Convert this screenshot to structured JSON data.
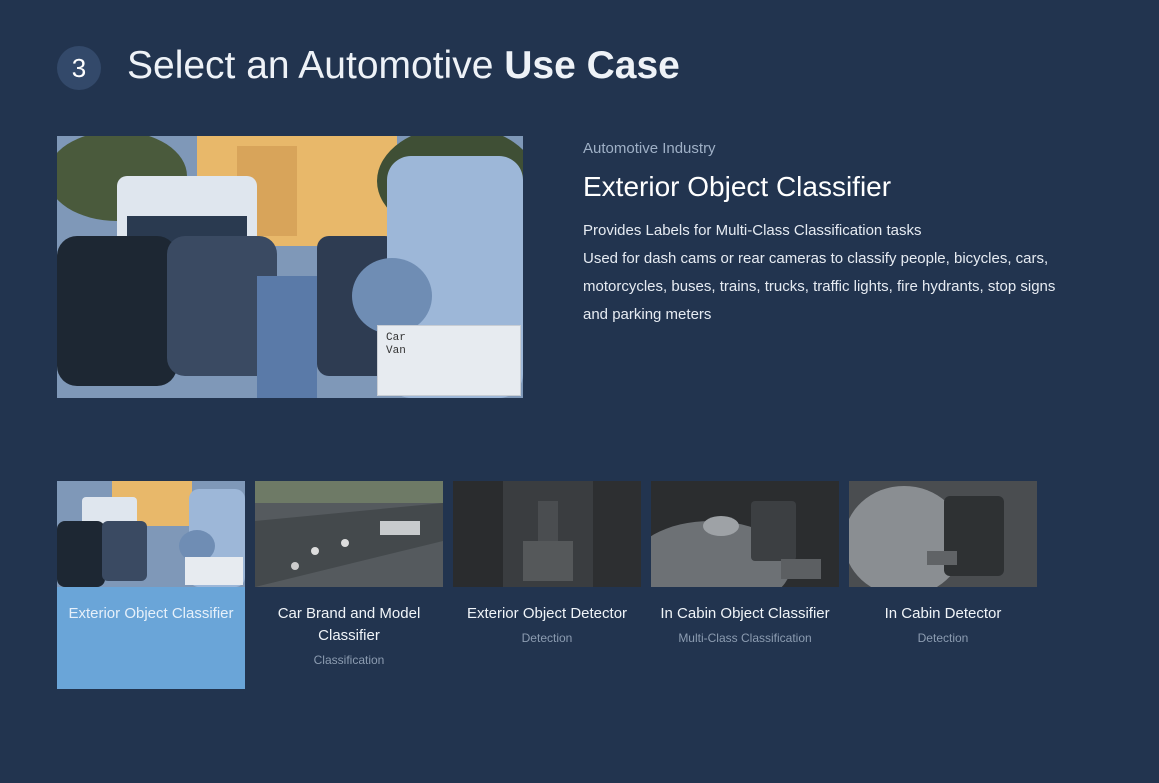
{
  "header": {
    "step_number": "3",
    "title_prefix": "Select an Automotive ",
    "title_emphasis": "Use Case"
  },
  "hero": {
    "label_lines": [
      "Car",
      "Van"
    ]
  },
  "detail": {
    "industry": "Automotive Industry",
    "title": "Exterior Object Classifier",
    "description_line1": "Provides Labels  for Multi-Class Classification tasks",
    "description_line2": "Used for dash cams or rear cameras to classify people, bicycles, cars, motorcycles, buses, trains, trucks, traffic lights, fire hydrants, stop signs and parking meters"
  },
  "cards": [
    {
      "title": "Exterior Object Classifier",
      "subtitle": "",
      "selected": true
    },
    {
      "title": "Car Brand and Model Classifier",
      "subtitle": "Classification",
      "selected": false
    },
    {
      "title": "Exterior Object Detector",
      "subtitle": "Detection",
      "selected": false
    },
    {
      "title": "In Cabin Object Classifier",
      "subtitle": "Multi-Class Classification",
      "selected": false
    },
    {
      "title": "In Cabin Detector",
      "subtitle": "Detection",
      "selected": false
    }
  ],
  "colors": {
    "background": "#22344f",
    "selected_card": "#6aa5d8",
    "badge": "#33496a"
  }
}
